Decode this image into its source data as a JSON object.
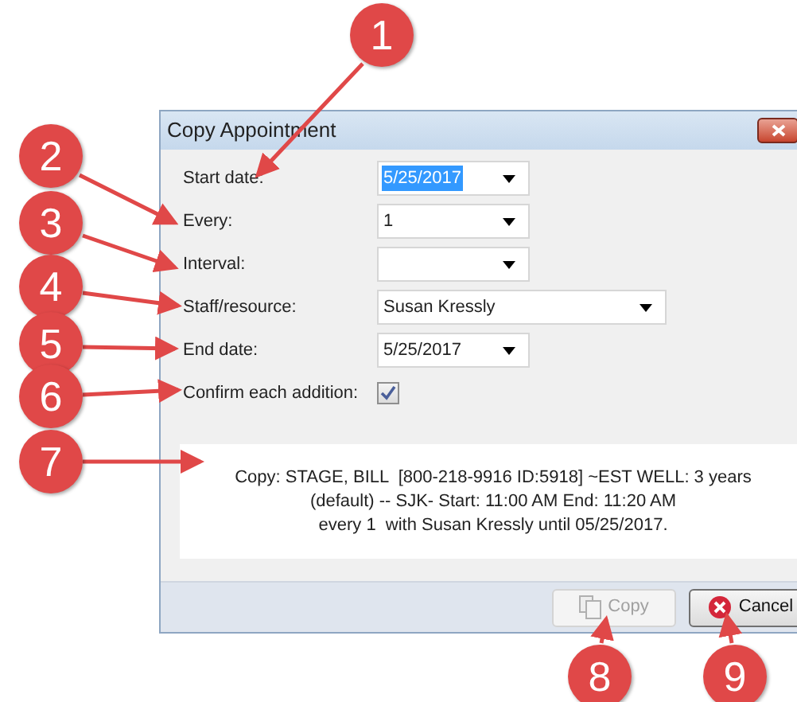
{
  "window": {
    "title": "Copy Appointment"
  },
  "fields": [
    {
      "kind": "dropdown",
      "label": "Start date:",
      "value": "5/25/2017",
      "highlighted": true
    },
    {
      "kind": "dropdown",
      "label": "Every:",
      "value": "1",
      "highlighted": false
    },
    {
      "kind": "dropdown",
      "label": "Interval:"
    },
    {
      "kind": "long-dropdown",
      "label": "Staff/resource:",
      "value": "Susan Kressly",
      "highlighted": false
    },
    {
      "kind": "dropdown",
      "label": "End date:",
      "value": "5/25/2017",
      "highlighted": false
    },
    {
      "kind": "checkbox",
      "label": "Confirm each addition:",
      "checked": true
    }
  ],
  "summary": [
    "Copy: STAGE, BILL  [800-218-9916 ID:5918] ~EST WELL: 3 years",
    "(default) -- SJK- Start: 11:00 AM End: 11:20 AM",
    "every 1  with Susan Kressly until 05/25/2017."
  ],
  "buttons": [
    {
      "kind": "copy",
      "label": "Copy",
      "disabled": true
    },
    {
      "kind": "cancel",
      "label": "Cancel",
      "disabled": false
    }
  ],
  "annotations": [
    "1",
    "2",
    "3",
    "4",
    "5",
    "6",
    "7",
    "8",
    "9"
  ]
}
